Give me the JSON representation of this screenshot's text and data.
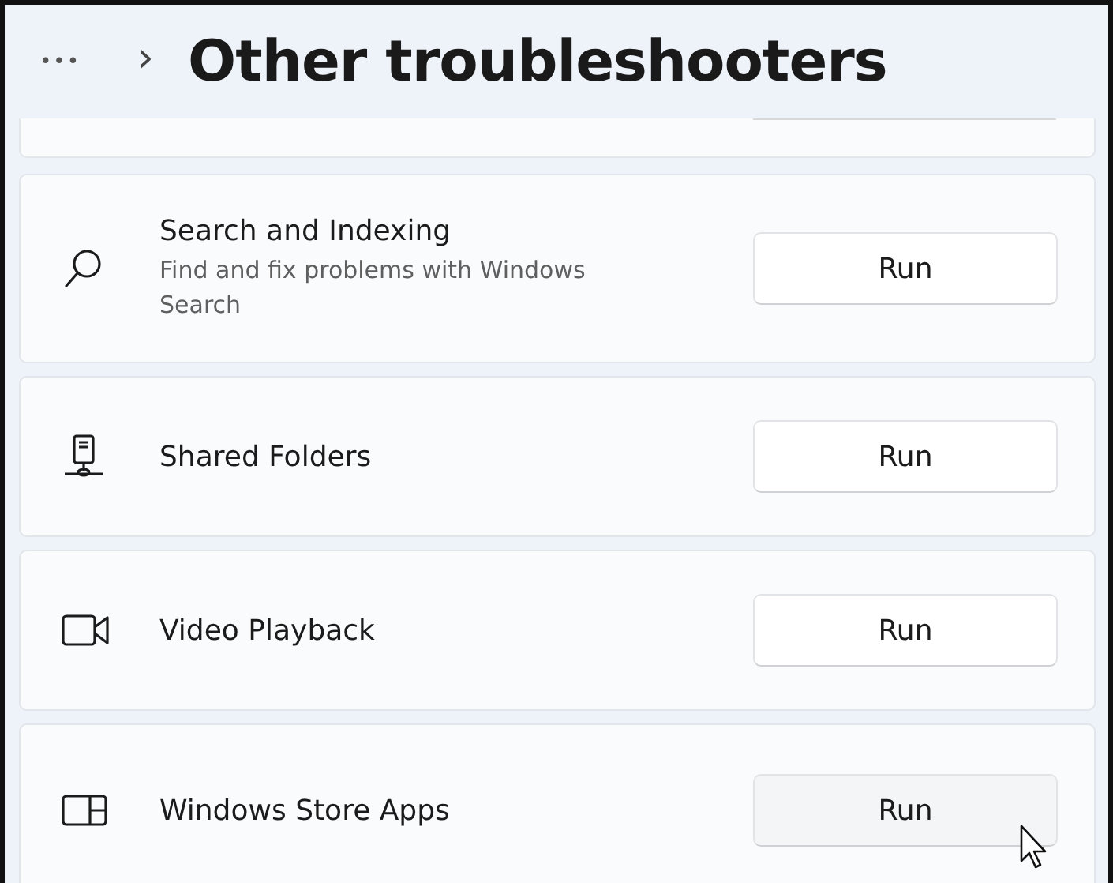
{
  "header": {
    "more": "•••",
    "chevron": "›",
    "title": "Other troubleshooters"
  },
  "items": [
    {
      "title": "Search and Indexing",
      "description": "Find and fix problems with Windows Search",
      "button": "Run",
      "hovered": false
    },
    {
      "title": "Shared Folders",
      "button": "Run",
      "hovered": false
    },
    {
      "title": "Video Playback",
      "button": "Run",
      "hovered": false
    },
    {
      "title": "Windows Store Apps",
      "button": "Run",
      "hovered": true
    }
  ]
}
